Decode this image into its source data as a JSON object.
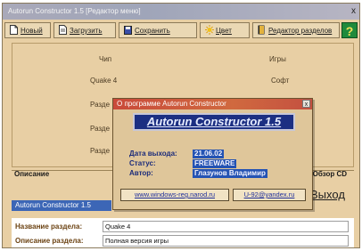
{
  "window": {
    "title": "Autorun Constructor 1.5 [Редактор меню]",
    "close": "x"
  },
  "toolbar": {
    "buttons": [
      {
        "label": "Новый",
        "icon": "document-icon"
      },
      {
        "label": "Загрузить",
        "icon": "open-file-icon"
      },
      {
        "label": "Сохранить",
        "icon": "save-icon"
      },
      {
        "label": "Цвет",
        "icon": "color-icon"
      },
      {
        "label": "Редактор разделов",
        "icon": "book-icon"
      }
    ],
    "help": "?"
  },
  "panel": {
    "labels": [
      "Чип",
      "Игры",
      "Quake 4",
      "Софт",
      "Разде",
      "Разде",
      "Разде"
    ]
  },
  "group": {
    "label": "Описание",
    "right_label": "Обзор CD"
  },
  "status": "Autorun Constructor 1.5",
  "exit": "Выход",
  "form": {
    "section_name_label": "Название раздела:",
    "section_name_value": "Quake 4",
    "section_desc_label": "Описание раздела:",
    "section_desc_value": "Полная версия игры"
  },
  "about": {
    "title": "О программе Autorun Constructor",
    "close": "x",
    "banner": "Autorun Constructor 1.5",
    "fields": [
      {
        "label": "Дата выхода:",
        "value": "21.06.02"
      },
      {
        "label": "Статус:",
        "value": "FREEWARE"
      },
      {
        "label": "Автор:",
        "value": "Глазунов Владимир"
      }
    ],
    "website": "www.windows-reg.narod.ru",
    "email": "U-92@yandex.ru"
  }
}
